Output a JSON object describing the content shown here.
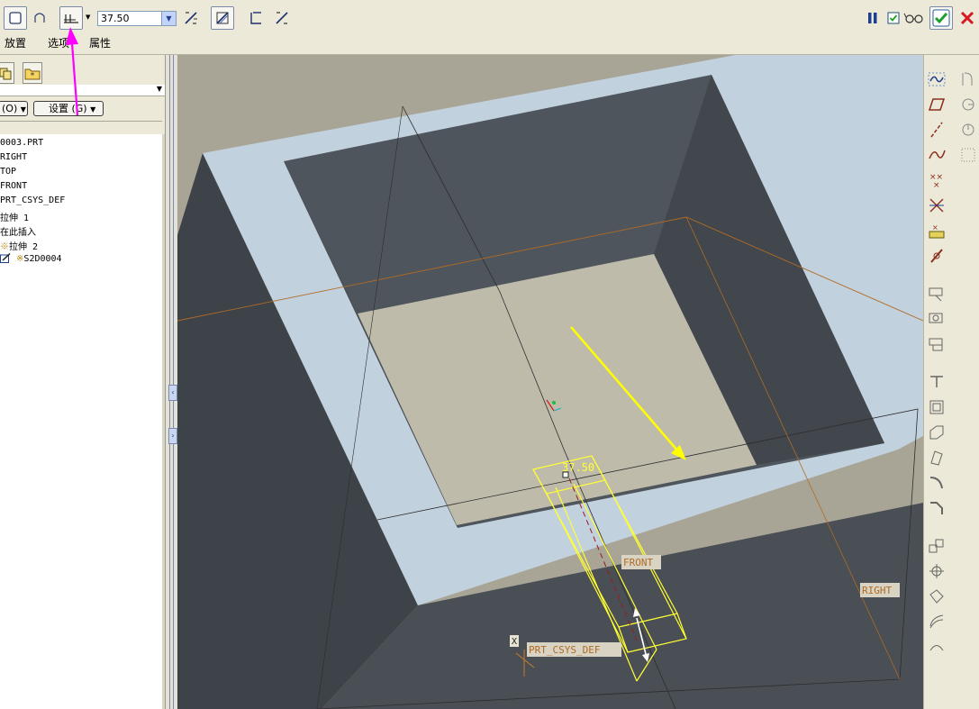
{
  "dashboard": {
    "depth_value": "37.50",
    "tabs": [
      "放置",
      "选项",
      "属性"
    ]
  },
  "model_tree": {
    "show_button": "(O)",
    "settings_button": "设置 (G)",
    "items": [
      {
        "label": "0003.PRT"
      },
      {
        "label": "RIGHT"
      },
      {
        "label": "TOP"
      },
      {
        "label": "FRONT"
      },
      {
        "label": "PRT_CSYS_DEF"
      },
      {
        "label": "拉伸 1"
      },
      {
        "label": "在此插入"
      },
      {
        "label": "拉伸 2"
      },
      {
        "label": "S2D0004"
      }
    ]
  },
  "viewport": {
    "dim_value": "37.50",
    "datum_labels": {
      "front": "FRONT",
      "right": "RIGHT",
      "csys": "PRT_CSYS_DEF",
      "x_axis": "X"
    }
  },
  "colors": {
    "annotation_arrow": "#ff00ff",
    "direction_arrow": "#ffff00",
    "preview_geometry": "#ffff33",
    "confirm_green": "#1e9e2e",
    "cancel_red": "#d71921",
    "datum_plane": "#c77a2a",
    "model_dark": "#4a4f55",
    "model_light": "#c2d1de"
  },
  "icons": {
    "dashboard": [
      "solid-icon",
      "surface-icon",
      "depth-blind-icon",
      "flip-direction-icon",
      "remove-material-icon",
      "thicken-icon",
      "flip-thicken-icon",
      "pause-icon",
      "preview-checkbox-icon",
      "glasses-icon",
      "confirm-icon",
      "cancel-icon"
    ],
    "right_toolbar": [
      "datum-analysis-icon",
      "datum-plane-icon",
      "datum-axis-icon",
      "datum-curve-icon",
      "datum-point-icon",
      "datum-offset-point-icon",
      "datum-field-point-icon",
      "csys-icon",
      "sketch-icon",
      "extrude-icon",
      "revolve-icon",
      "sweep-icon",
      "hole-icon",
      "shell-icon",
      "rib-icon",
      "draft-icon",
      "round-icon",
      "chamfer-icon",
      "pattern-icon",
      "mirror-icon",
      "merge-icon",
      "trim-icon",
      "offset-icon",
      "thicken-tool-icon"
    ]
  }
}
